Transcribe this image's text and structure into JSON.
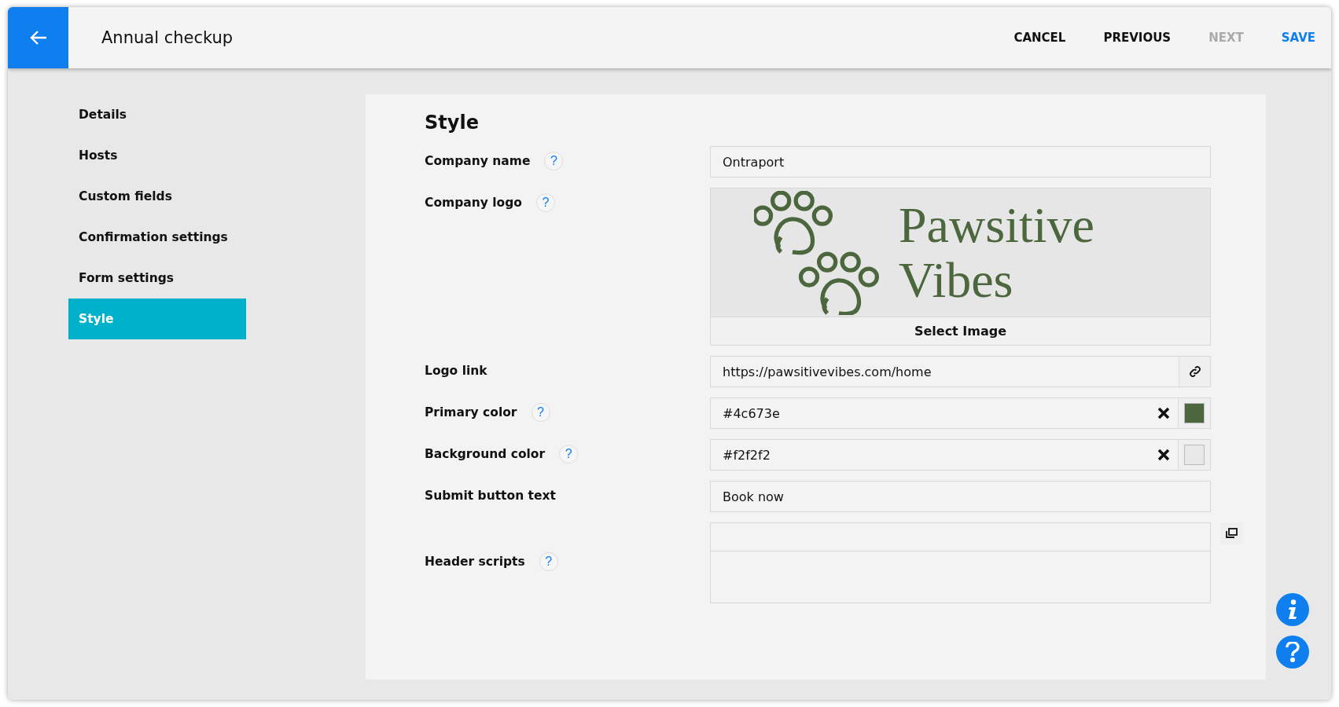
{
  "header": {
    "title": "Annual checkup",
    "actions": [
      {
        "label": "CANCEL",
        "kind": "default",
        "disabled": false
      },
      {
        "label": "PREVIOUS",
        "kind": "default",
        "disabled": false
      },
      {
        "label": "NEXT",
        "kind": "default",
        "disabled": true
      },
      {
        "label": "SAVE",
        "kind": "primary",
        "disabled": false
      }
    ]
  },
  "sidebar": {
    "items": [
      {
        "label": "Details",
        "selected": false
      },
      {
        "label": "Hosts",
        "selected": false
      },
      {
        "label": "Custom fields",
        "selected": false
      },
      {
        "label": "Confirmation settings",
        "selected": false
      },
      {
        "label": "Form settings",
        "selected": false
      },
      {
        "label": "Style",
        "selected": true
      }
    ]
  },
  "panel": {
    "title": "Style",
    "rows": [
      {
        "label": "Company name",
        "help": "?",
        "kind": "text",
        "value": "Ontraport"
      },
      {
        "label": "Company logo",
        "help": "?",
        "kind": "logo",
        "logo_lines": [
          "Pawsitive",
          "Vibes"
        ],
        "button": "Select Image"
      },
      {
        "label": "Logo link",
        "kind": "link",
        "value": "https://pawsitivevibes.com/home"
      },
      {
        "label": "Primary color",
        "help": "?",
        "kind": "color",
        "value": "#4c673e",
        "color": "#4c673e"
      },
      {
        "label": "Background color",
        "help": "?",
        "kind": "color",
        "value": "#f2f2f2",
        "color": "#e8e8e8"
      },
      {
        "label": "Submit button text",
        "kind": "text",
        "value": "Book now"
      },
      {
        "label": "Header scripts",
        "help": "?",
        "kind": "scripts"
      }
    ]
  }
}
